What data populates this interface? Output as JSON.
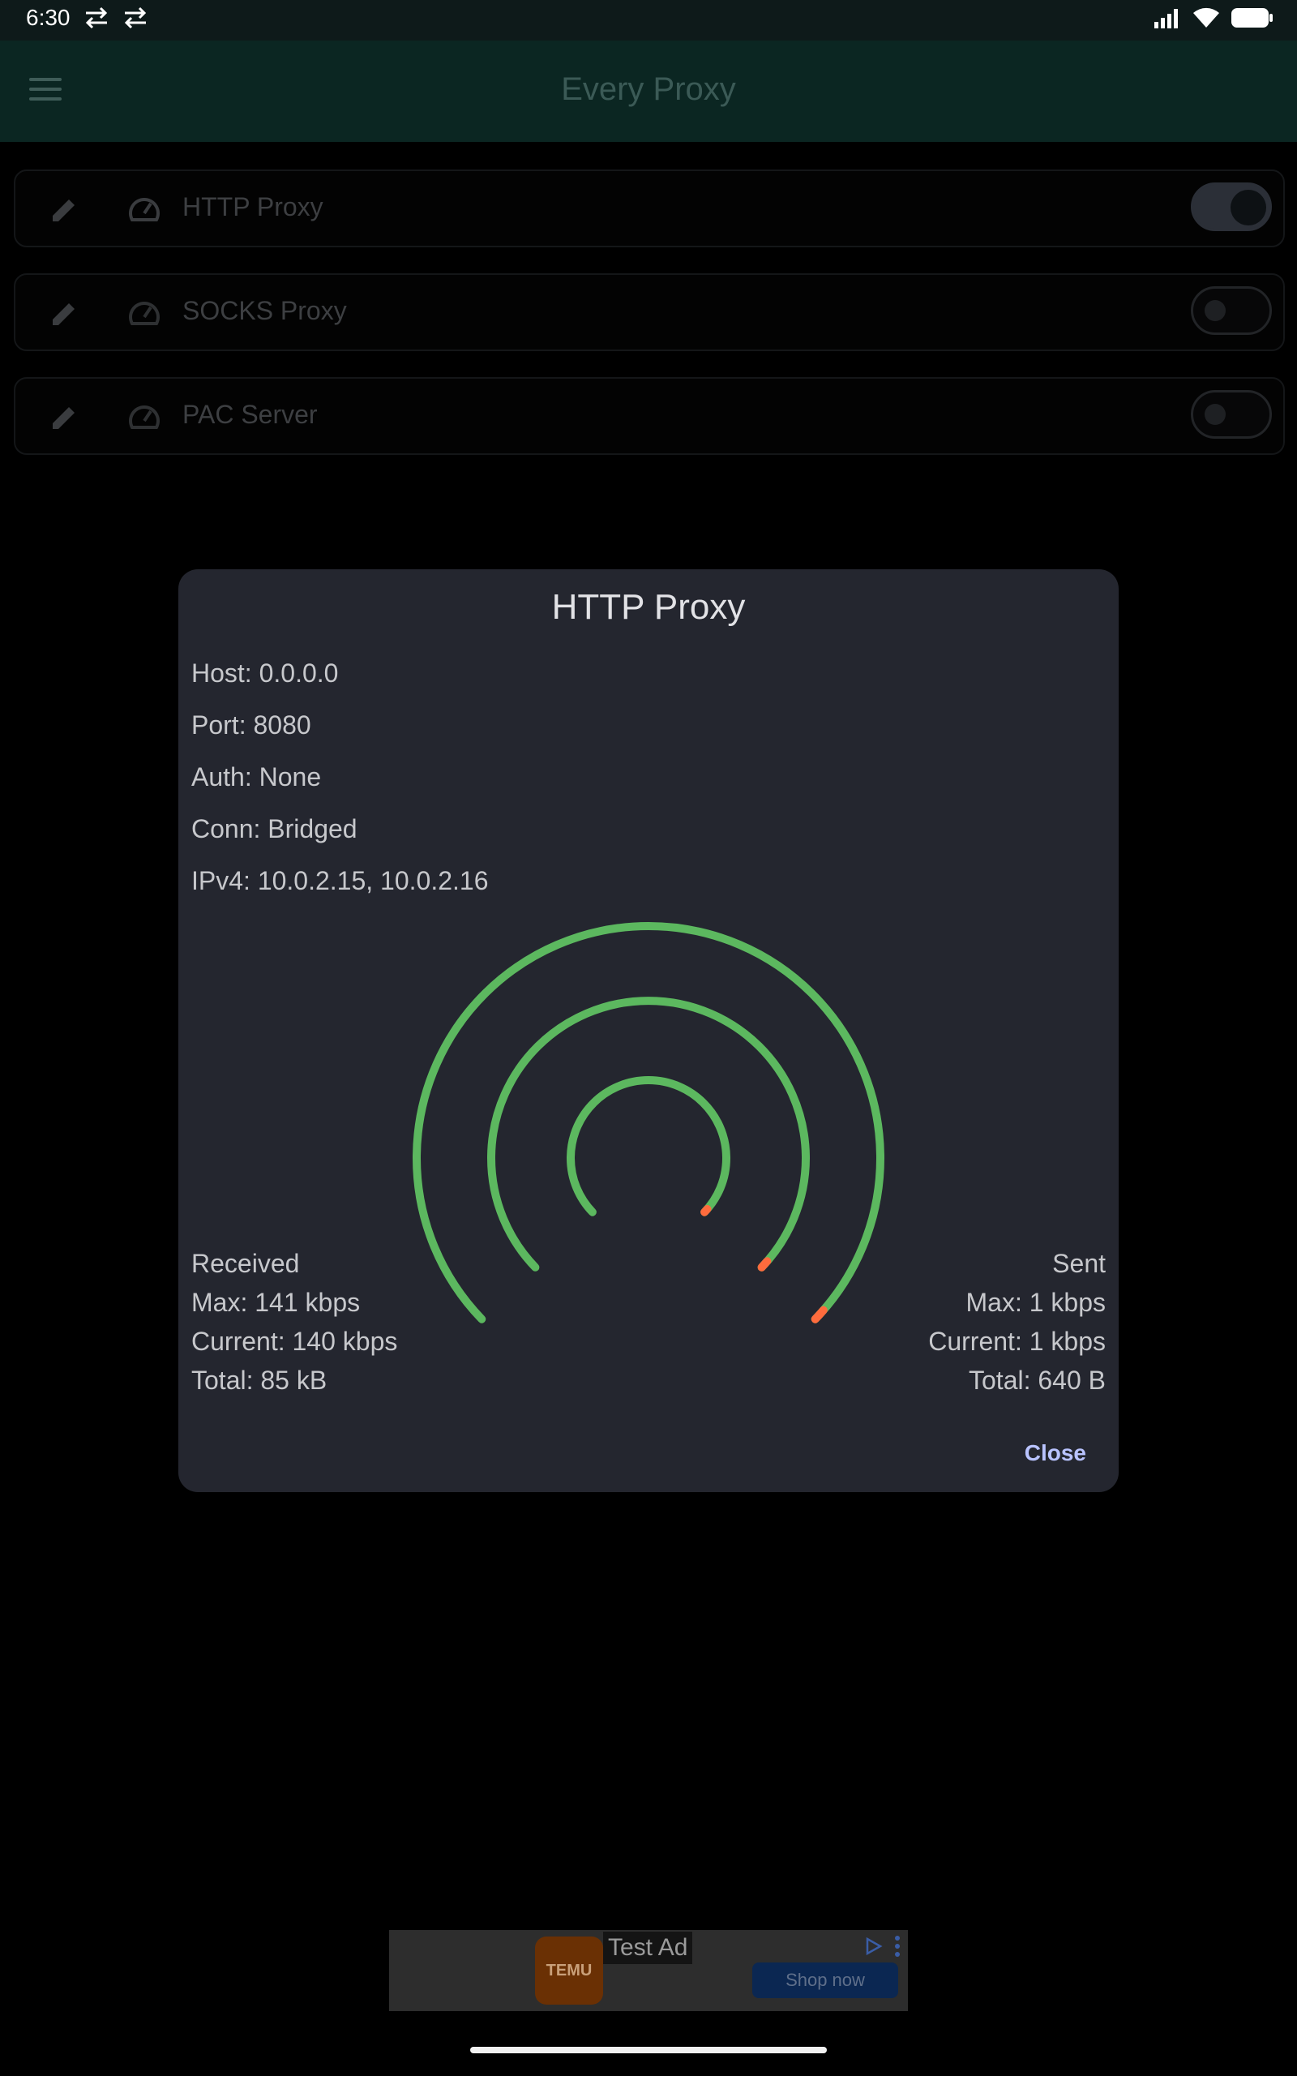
{
  "status_bar": {
    "time": "6:30"
  },
  "app_bar": {
    "title": "Every Proxy"
  },
  "proxies": [
    {
      "label": "HTTP Proxy",
      "enabled": true
    },
    {
      "label": "SOCKS Proxy",
      "enabled": false
    },
    {
      "label": "PAC Server",
      "enabled": false
    }
  ],
  "dialog": {
    "title": "HTTP Proxy",
    "host": "Host: 0.0.0.0",
    "port": "Port: 8080",
    "auth": "Auth: None",
    "conn": "Conn: Bridged",
    "ipv4": "IPv4: 10.0.2.15, 10.0.2.16",
    "received": {
      "heading": "Received",
      "max": "Max: 141 kbps",
      "current": "Current: 140 kbps",
      "total": "Total: 85 kB"
    },
    "sent": {
      "heading": "Sent",
      "max": "Max: 1 kbps",
      "current": "Current: 1 kbps",
      "total": "Total: 640 B"
    },
    "close_label": "Close"
  },
  "gauge_colors": {
    "track": "#5cb85f",
    "indicator": "#ff6b3d"
  },
  "ad": {
    "label": "Test Ad",
    "brand": "TEMU",
    "cta": "Shop now"
  }
}
